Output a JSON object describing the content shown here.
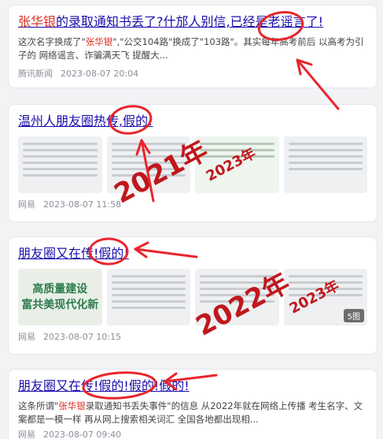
{
  "results": [
    {
      "title_parts": [
        "张华银",
        "的录取通知书丢了?什邡人别信,已经是老谣言了!"
      ],
      "snippet_parts": [
        "这次名字换成了\"",
        "张华银",
        "\",\"公交104路\"换成了\"103路\"。其实每年高考前后 以高考为引子的 网络谣言、诈骗满天飞 提醒大..."
      ],
      "source": "腾讯新闻",
      "date": "2023-08-07 20:04"
    },
    {
      "title": "温州人朋友圈热传,假的!",
      "source": "网易",
      "date": "2023-08-07 11:58",
      "stamps": [
        "2021年",
        "2023年"
      ]
    },
    {
      "title": "朋友圈又在传!假的!",
      "source": "网易",
      "date": "2023-08-07 10:15",
      "poster_lines": [
        "高质量建设",
        "富共美现代化新"
      ],
      "image_count": "5图",
      "stamps": [
        "2022年",
        "2023年"
      ]
    },
    {
      "title": "朋友圈又在传!假的!假的!假的!",
      "snippet_parts": [
        "这条所谓\"",
        "张华银",
        "录取通知书丢失事件\"的信息 从2022年就在网络上传播 考生名字、文案都是一模一样 再从网上搜索相关词汇 全国各地都出现相..."
      ],
      "source": "网易",
      "date": "2023-08-07 09:40"
    }
  ],
  "colors": {
    "link": "#1a0dab",
    "highlight": "#d93025",
    "annotation": "#e8262b"
  }
}
